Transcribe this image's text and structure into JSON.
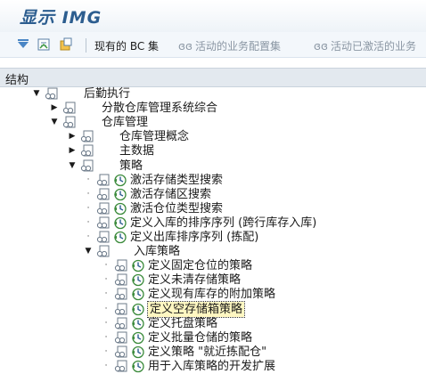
{
  "title": "显示 IMG",
  "toolbar": {
    "existing_bc_sets": "现有的 BC 集",
    "active_business_config_sets": "活动的业务配置集",
    "activated_business": "活动已激活的业务"
  },
  "structure_header": "结构",
  "tree": [
    {
      "label": "后勤执行",
      "level": 0,
      "state": "expanded",
      "exec": false
    },
    {
      "label": "分散仓库管理系统综合",
      "level": 1,
      "state": "collapsed",
      "exec": false
    },
    {
      "label": "仓库管理",
      "level": 1,
      "state": "expanded",
      "exec": false
    },
    {
      "label": "仓库管理概念",
      "level": 2,
      "state": "collapsed",
      "exec": false
    },
    {
      "label": "主数据",
      "level": 2,
      "state": "collapsed",
      "exec": false
    },
    {
      "label": "策略",
      "level": 2,
      "state": "expanded",
      "exec": false
    },
    {
      "label": "激活存储类型搜索",
      "level": 3,
      "state": "leaf",
      "exec": true
    },
    {
      "label": "激活存储区搜索",
      "level": 3,
      "state": "leaf",
      "exec": true
    },
    {
      "label": "激活仓位类型搜索",
      "level": 3,
      "state": "leaf",
      "exec": true
    },
    {
      "label": "定义入库的排序序列 (跨行库存入库)",
      "level": 3,
      "state": "leaf",
      "exec": true
    },
    {
      "label": "定义出库排序序列 (拣配)",
      "level": 3,
      "state": "leaf",
      "exec": true
    },
    {
      "label": "入库策略",
      "level": 3,
      "state": "expanded",
      "exec": false
    },
    {
      "label": "定义固定仓位的策略",
      "level": 4,
      "state": "leaf",
      "exec": true
    },
    {
      "label": "定义未清存储策略",
      "level": 4,
      "state": "leaf",
      "exec": true
    },
    {
      "label": "定义现有库存的附加策略",
      "level": 4,
      "state": "leaf",
      "exec": true
    },
    {
      "label": "定义空存储箱策略",
      "level": 4,
      "state": "leaf",
      "exec": true,
      "selected": true
    },
    {
      "label": "定义托盘策略",
      "level": 4,
      "state": "leaf",
      "exec": true
    },
    {
      "label": "定义批量仓储的策略",
      "level": 4,
      "state": "leaf",
      "exec": true
    },
    {
      "label": "定义策略 \"就近拣配仓\"",
      "level": 4,
      "state": "leaf",
      "exec": true
    },
    {
      "label": "用于入库策略的开发扩展",
      "level": 4,
      "state": "leaf",
      "exec": true
    }
  ]
}
